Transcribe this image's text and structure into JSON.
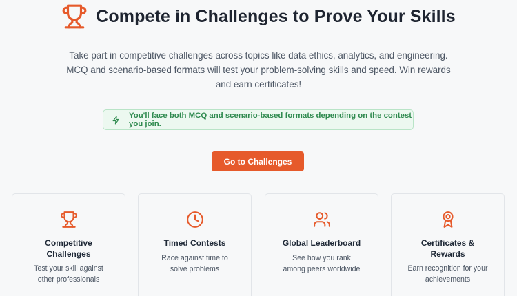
{
  "hero": {
    "icon": "trophy-icon",
    "title": "Compete in Challenges to Prove Your Skills"
  },
  "description": "Take part in competitive challenges across topics like data ethics, analytics, and engineering. MCQ and scenario-based formats will test your problem-solving skills and speed. Win rewards and earn certificates!",
  "callout": {
    "icon": "sparkle-icon",
    "text": "You'll face both MCQ and scenario-based formats depending on the contest you join."
  },
  "cta": {
    "label": "Go to Challenges"
  },
  "features": [
    {
      "icon": "trophy-icon",
      "title": "Competitive Challenges",
      "subtitle": "Test your skill against other professionals"
    },
    {
      "icon": "clock-icon",
      "title": "Timed Contests",
      "subtitle": "Race against time to solve problems"
    },
    {
      "icon": "users-icon",
      "title": "Global Leaderboard",
      "subtitle": "See how you rank among peers worldwide"
    },
    {
      "icon": "award-icon",
      "title": "Certificates & Rewards",
      "subtitle": "Earn recognition for your achievements"
    }
  ],
  "colors": {
    "accent": "#e65a2b",
    "callout_bg": "#ecf8f0",
    "callout_text": "#2f8a4f"
  }
}
